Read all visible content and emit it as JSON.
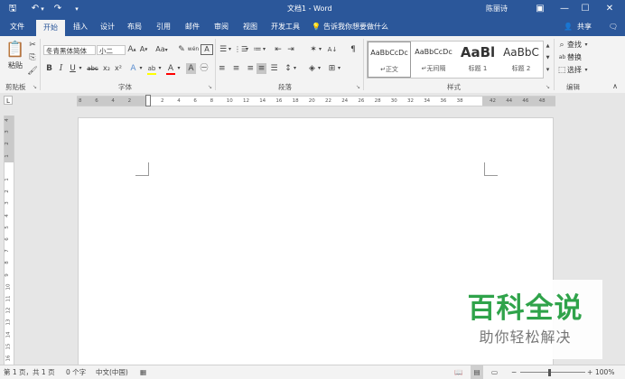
{
  "window": {
    "title": "文档1 - Word",
    "user": "陈丽诗",
    "restore_icon": "ribbon-display-options-icon",
    "min_icon": "minimize-icon",
    "max_icon": "maximize-icon",
    "close_icon": "close-icon",
    "min_glyph": "—",
    "max_glyph": "☐",
    "close_glyph": "✕",
    "options_glyph": "▣"
  },
  "qat": {
    "save_glyph": "🖫",
    "undo_glyph": "↶",
    "undo_drop": "▾",
    "redo_glyph": "↷",
    "customize_glyph": "▾"
  },
  "tabs": [
    "文件",
    "开始",
    "插入",
    "设计",
    "布局",
    "引用",
    "邮件",
    "审阅",
    "视图",
    "开发工具"
  ],
  "tell_me": "告诉我你想要做什么",
  "tell_me_glyph": "💡",
  "share": {
    "label": "共享",
    "glyph": "👤"
  },
  "comment_glyph": "🗨",
  "ribbon": {
    "clipboard": {
      "paste_label": "粘贴",
      "paste_glyph": "📋",
      "cut_glyph": "✂",
      "copy_glyph": "⎘",
      "format_painter_glyph": "🖌",
      "group_label": "剪贴板",
      "launcher": "↘"
    },
    "font": {
      "font_name": "冬青黑体简体",
      "font_size": "小二",
      "grow": "A",
      "grow_sup": "▲",
      "shrink": "A",
      "shrink_sup": "▼",
      "case": "Aa",
      "case_drop": "▾",
      "clear_glyph": "✎",
      "phonetic": "wén",
      "border_char": "A",
      "bold": "B",
      "italic": "I",
      "underline": "U",
      "underline_drop": "▾",
      "strike": "abc",
      "subscript": "x₂",
      "superscript": "x²",
      "effects": "A",
      "highlight": "ab",
      "font_color": "A",
      "shading": "A",
      "enclose": "㊀",
      "drop": "▾",
      "group_label": "字体",
      "launcher": "↘",
      "highlight_color": "#ffff00",
      "font_color_bar": "#ff0000"
    },
    "paragraph": {
      "bullets": "☰",
      "numbering": "⋮☰",
      "multilevel": "≔",
      "decrease_indent": "⇤",
      "increase_indent": "⇥",
      "asian_layout": "✶",
      "sort": "A↓",
      "show_marks": "¶",
      "align_left": "≡",
      "align_center": "≡",
      "align_right": "≡",
      "justify": "≡",
      "distributed": "☰",
      "line_spacing": "↕",
      "shading_glyph": "◈",
      "borders_glyph": "⊞",
      "drop": "▾",
      "group_label": "段落",
      "launcher": "↘"
    },
    "styles": {
      "items": [
        {
          "preview": "AaBbCcDc",
          "name": "正文",
          "mark": "↵"
        },
        {
          "preview": "AaBbCcDc",
          "name": "无间隔",
          "mark": "↵"
        },
        {
          "preview": "AaBl",
          "name": "标题 1",
          "mark": ""
        },
        {
          "preview": "AaBbC",
          "name": "标题 2",
          "mark": ""
        }
      ],
      "scroll_up": "▲",
      "scroll_down": "▼",
      "more": "▾",
      "group_label": "样式",
      "launcher": "↘"
    },
    "editing": {
      "find": "查找",
      "find_glyph": "⌕",
      "replace": "替换",
      "replace_glyph": "ab",
      "select": "选择",
      "select_glyph": "⬚",
      "drop": "▾",
      "group_label": "编辑",
      "collapse": "∧"
    }
  },
  "ruler": {
    "horizontal": [
      "8",
      "6",
      "4",
      "2",
      "",
      "2",
      "4",
      "6",
      "8",
      "10",
      "12",
      "14",
      "16",
      "18",
      "20",
      "22",
      "24",
      "26",
      "28",
      "30",
      "32",
      "34",
      "36",
      "38",
      "",
      "42",
      "44",
      "46",
      "48"
    ],
    "vertical": [
      "4",
      "3",
      "2",
      "1",
      "",
      "1",
      "2",
      "3",
      "4",
      "5",
      "6",
      "7",
      "8",
      "9",
      "10",
      "11",
      "12",
      "13",
      "14",
      "15",
      "16"
    ],
    "corner": "L"
  },
  "status": {
    "page": "第 1 页，共 1 页",
    "words": "0 个字",
    "language": "中文(中国)",
    "macro_glyph": "▦",
    "zoom": "100%",
    "zoom_minus": "−",
    "zoom_plus": "+",
    "view_read": "📖",
    "view_print": "▤",
    "view_web": "▭"
  },
  "watermark": {
    "title": "百科全说",
    "subtitle": "助你轻松解决",
    "color": "#2fa34a"
  },
  "colors": {
    "accent": "#2b579a",
    "ribbon": "#f3f3f3",
    "canvas": "#e6e6e6"
  }
}
